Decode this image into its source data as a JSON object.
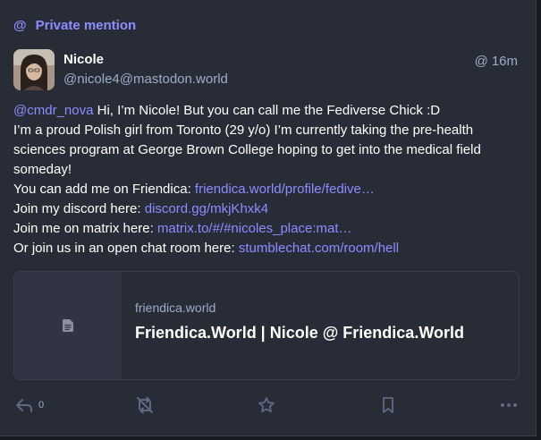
{
  "prepend": {
    "icon": "at-icon",
    "label": "Private mention"
  },
  "author": {
    "display_name": "Nicole",
    "acct": "@nicole4@mastodon.world"
  },
  "timestamp": {
    "icon": "at-icon",
    "label": "16m"
  },
  "content": {
    "mention": "@cmdr_nova",
    "line1_rest": " Hi, I’m Nicole! But you can call me the Fediverse Chick :D",
    "line2": "I’m a proud Polish girl from Toronto (29 y/o) I’m currently taking the pre-health sciences program at George Brown College hoping to get into the medical field someday!",
    "friendica_prefix": "You can add me on Friendica: ",
    "friendica_link": "friendica.world/profile/fedive…",
    "discord_prefix": "Join my discord here: ",
    "discord_link": "discord.gg/mkjKhxk4",
    "matrix_prefix": "Join me on matrix here: ",
    "matrix_link": "matrix.to/#/#nicoles_place:mat…",
    "chat_prefix": "Or join us in an open chat room here: ",
    "chat_link": "stumblechat.com/room/hell"
  },
  "card": {
    "icon": "document-icon",
    "provider": "friendica.world",
    "title": "Friendica.World | Nicole @ Friendica.World"
  },
  "actions": {
    "reply_icon": "reply-icon",
    "reply_count": "0",
    "boost_icon": "boost-disabled-icon",
    "favourite_icon": "star-icon",
    "bookmark_icon": "bookmark-icon",
    "more_icon": "more-horizontal-icon"
  },
  "colors": {
    "accent": "#8c8dff",
    "background": "#282c37",
    "muted_text": "#9baec8",
    "icon": "#606984"
  }
}
